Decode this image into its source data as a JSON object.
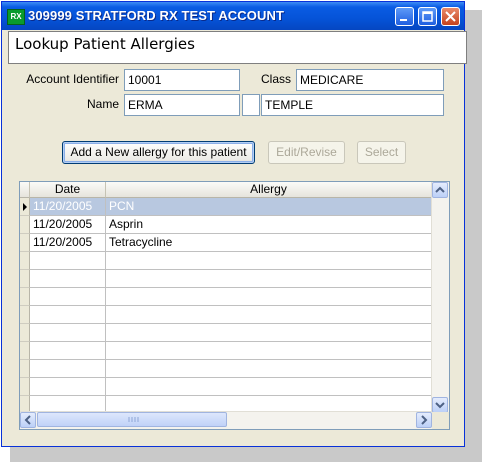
{
  "window": {
    "title": "309999 STRATFORD RX TEST ACCOUNT",
    "app_icon_text": "RX",
    "controls": [
      "minimize",
      "maximize",
      "close"
    ]
  },
  "header": {
    "title": "Lookup Patient Allergies"
  },
  "form": {
    "account_identifier_label": "Account Identifier",
    "account_identifier_value": "10001",
    "class_label": "Class",
    "class_value": "MEDICARE",
    "name_label": "Name",
    "first_name_value": "ERMA",
    "middle_initial_value": "",
    "last_name_value": "TEMPLE"
  },
  "buttons": {
    "add_allergy": "Add a New allergy for this patient",
    "edit_revise": "Edit/Revise",
    "select": "Select"
  },
  "grid": {
    "columns": [
      "Date",
      "Allergy"
    ],
    "rows": [
      {
        "date": "11/20/2005",
        "allergy": "PCN",
        "selected": true
      },
      {
        "date": "11/20/2005",
        "allergy": "Asprin",
        "selected": false
      },
      {
        "date": "11/20/2005",
        "allergy": "Tetracycline",
        "selected": false
      }
    ],
    "empty_rows": 10
  },
  "colors": {
    "titlebar": "#0553d8",
    "selected_row": "#b8c8e0",
    "window_bg": "#ece9d8"
  }
}
